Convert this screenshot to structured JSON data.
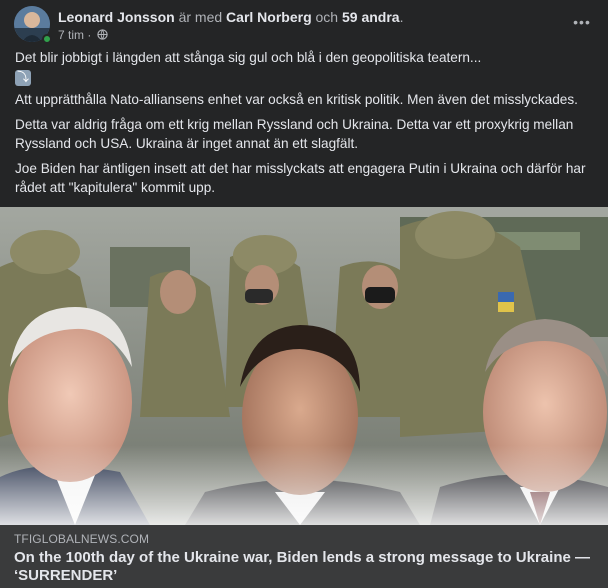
{
  "post": {
    "author": "Leonard Jonsson",
    "with_text": "är med",
    "tagged": "Carl Norberg",
    "and_text": "och",
    "others": "59 andra",
    "period": ".",
    "time": "7 tim",
    "dot": "·",
    "audience_icon": "globe-icon",
    "more_icon": "more-horizontal-icon",
    "paragraphs": [
      "Det blir jobbigt i längden att stånga sig gul och blå i den geopolitiska teatern...",
      "Att upprätthålla Nato-alliansens enhet var också en kritisk politik. Men även det misslyckades.",
      "Detta var aldrig fråga om ett krig mellan Ryssland och Ukraina. Detta var ett proxykrig mellan Ryssland och USA. Ukraina är inget annat än ett slagfält.",
      "Joe Biden har äntligen insett att det har misslyckats att engagera Putin i Ukraina och därför har rådet att \"kapitulera\" kommit upp."
    ],
    "emoji": "arrow-down-right-emoji"
  },
  "link": {
    "domain": "TFIGLOBALNEWS.COM",
    "headline": "On the 100th day of the Ukraine war, Biden lends a strong message to Ukraine — ‘SURRENDER’"
  },
  "colors": {
    "background": "#242526",
    "link_card": "#3a3b3c",
    "text_primary": "#e4e6eb",
    "text_secondary": "#b0b3b8",
    "online": "#31a24c"
  }
}
